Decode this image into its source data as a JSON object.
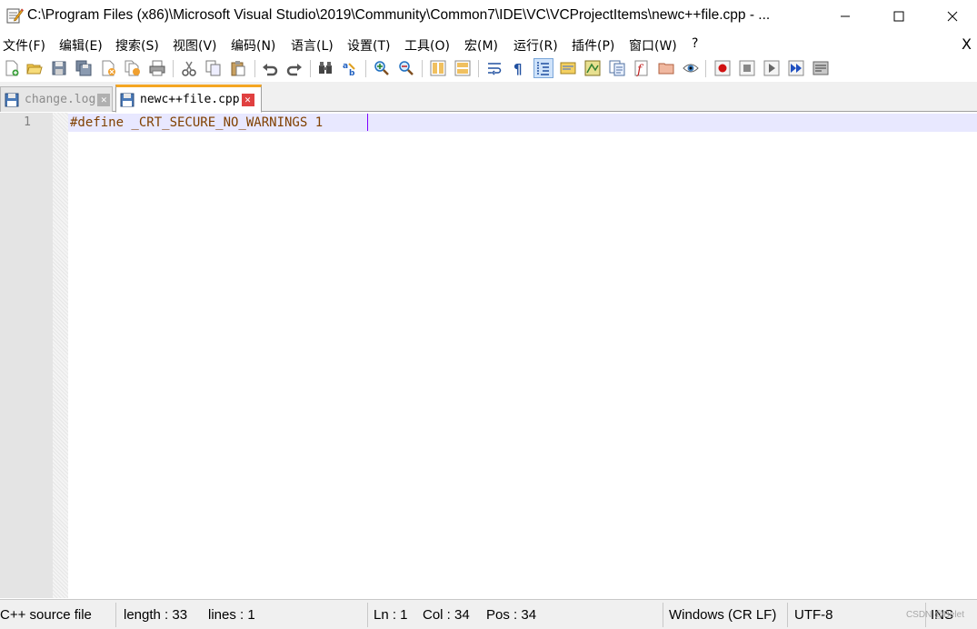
{
  "window": {
    "title": "C:\\Program Files (x86)\\Microsoft Visual Studio\\2019\\Community\\Common7\\IDE\\VC\\VCProjectItems\\newc++file.cpp - ...",
    "minimize_glyph": "—",
    "maximize_glyph": "☐",
    "close_glyph": "✕"
  },
  "menu": {
    "items": [
      "文件(F)",
      "编辑(E)",
      "搜索(S)",
      "视图(V)",
      "编码(N)",
      "语言(L)",
      "设置(T)",
      "工具(O)",
      "宏(M)",
      "运行(R)",
      "插件(P)",
      "窗口(W)",
      "?"
    ],
    "close_glyph": "X"
  },
  "toolbar": {
    "icons": [
      "new-file-icon",
      "open-file-icon",
      "save-icon",
      "save-all-icon",
      "close-icon",
      "close-all-icon",
      "print-icon",
      "cut-icon",
      "copy-icon",
      "paste-icon",
      "undo-icon",
      "redo-icon",
      "find-icon",
      "replace-icon",
      "zoom-in-icon",
      "zoom-out-icon",
      "sync-vertical-icon",
      "sync-horizontal-icon",
      "word-wrap-icon",
      "show-all-chars-icon",
      "indent-guide-icon",
      "user-language-icon",
      "doc-map-icon",
      "function-list-icon",
      "folder-as-workspace-icon",
      "monitoring-icon",
      "record-macro-icon",
      "stop-macro-icon",
      "play-macro-icon",
      "run-macro-multiple-icon",
      "save-macro-icon"
    ]
  },
  "tabs": [
    {
      "label": "change.log",
      "active": false
    },
    {
      "label": "newc++file.cpp",
      "active": true
    }
  ],
  "editor": {
    "lines": [
      {
        "number": "1",
        "text": "#define _CRT_SECURE_NO_WARNINGS 1"
      }
    ]
  },
  "status": {
    "language": "C++ source file",
    "length": "length : 33",
    "lines": "lines : 1",
    "ln": "Ln : 1",
    "col": "Col : 34",
    "pos": "Pos : 34",
    "eol": "Windows (CR LF)",
    "encoding": "UTF-8",
    "mode": "INS",
    "watermark": "CSDN @Belet"
  },
  "colors": {
    "accent_tab": "#f5a623",
    "preprocessor": "#804000",
    "caret": "#8000ff",
    "current_line": "#e8e8ff"
  }
}
